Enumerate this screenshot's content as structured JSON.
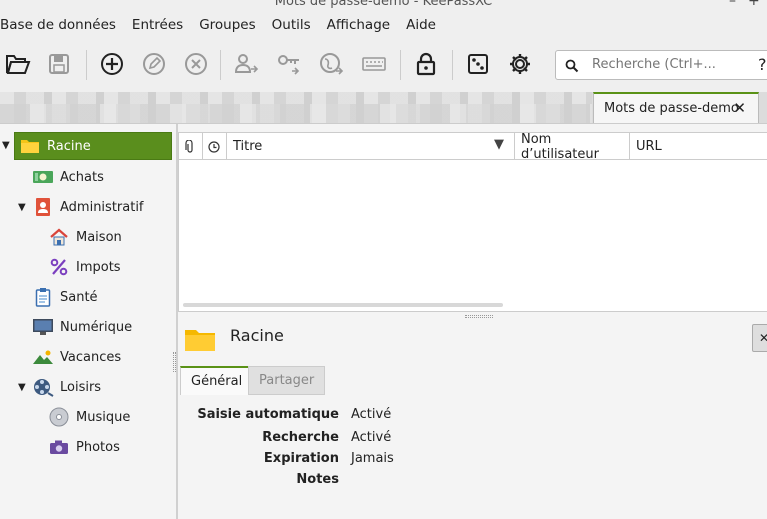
{
  "window": {
    "title": "Mots de passe-demo - KeePassXC",
    "minimize_glyph": "–",
    "maximize_glyph": "+"
  },
  "menu": [
    "Base de données",
    "Entrées",
    "Groupes",
    "Outils",
    "Affichage",
    "Aide"
  ],
  "toolbar": {
    "icons": [
      "open-database-icon",
      "save-database-icon",
      "add-entry-icon",
      "edit-entry-icon",
      "delete-entry-icon",
      "copy-username-icon",
      "copy-password-icon",
      "copy-url-icon",
      "autotype-icon",
      "lock-database-icon",
      "password-generator-icon",
      "settings-icon"
    ]
  },
  "search": {
    "placeholder": "Recherche (Ctrl+...",
    "help_label": "?"
  },
  "db_tab": {
    "label": "Mots de passe-demo",
    "close": "✕"
  },
  "tree": [
    {
      "label": "Racine",
      "icon": "folder-icon",
      "level": 0,
      "expanded": true,
      "selected": true
    },
    {
      "label": "Achats",
      "icon": "money-icon",
      "level": 1
    },
    {
      "label": "Administratif",
      "icon": "contact-book-icon",
      "level": 1,
      "expanded": true
    },
    {
      "label": "Maison",
      "icon": "house-icon",
      "level": 2
    },
    {
      "label": "Impots",
      "icon": "percent-icon",
      "level": 2
    },
    {
      "label": "Santé",
      "icon": "clipboard-icon",
      "level": 1
    },
    {
      "label": "Numérique",
      "icon": "monitor-icon",
      "level": 1
    },
    {
      "label": "Vacances",
      "icon": "landscape-icon",
      "level": 1
    },
    {
      "label": "Loisirs",
      "icon": "film-reel-icon",
      "level": 1,
      "expanded": true
    },
    {
      "label": "Musique",
      "icon": "cd-icon",
      "level": 2
    },
    {
      "label": "Photos",
      "icon": "camera-icon",
      "level": 2
    }
  ],
  "entries_table": {
    "columns": [
      "Titre",
      "Nom d’utilisateur",
      "URL"
    ],
    "sort_indicator": "▼"
  },
  "details": {
    "title": "Racine",
    "tabs": [
      "Général",
      "Partager"
    ],
    "fields": [
      {
        "label": "Saisie automatique",
        "value": "Activé"
      },
      {
        "label": "Recherche",
        "value": "Activé"
      },
      {
        "label": "Expiration",
        "value": "Jamais"
      },
      {
        "label": "Notes",
        "value": ""
      }
    ]
  },
  "colors": {
    "accent": "#5a8e1d",
    "folder": "#f5c518"
  }
}
